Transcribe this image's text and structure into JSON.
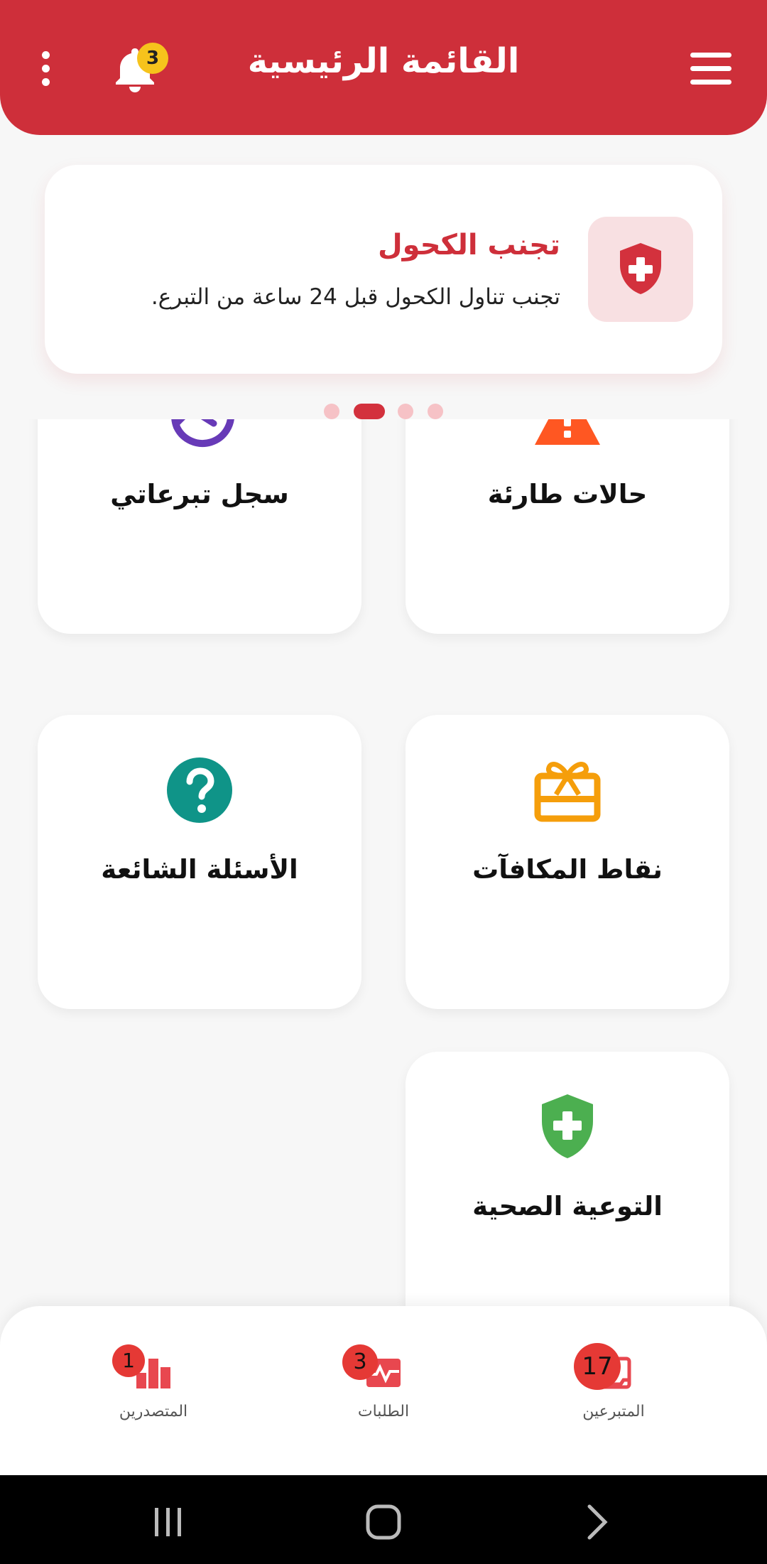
{
  "header": {
    "title": "القائمة الرئيسية",
    "notification_count": "3",
    "accent_color": "#CE2F3A"
  },
  "banner": {
    "title": "تجنب الكحول",
    "text": "تجنب تناول الكحول قبل 24 ساعة من التبرع.",
    "icon": "shield-plus-icon",
    "page_index": 2,
    "page_count": 4
  },
  "grid": {
    "items": [
      {
        "label": "حالات طارئة",
        "icon": "warning-icon",
        "color": "#FF5722"
      },
      {
        "label": "سجل تبرعاتي",
        "icon": "history-icon",
        "color": "#673AB7"
      },
      {
        "label": "نقاط المكافآت",
        "icon": "gift-card-icon",
        "color": "#F59E0B"
      },
      {
        "label": "الأسئلة الشائعة",
        "icon": "question-icon",
        "color": "#0F9488"
      },
      {
        "label": "التوعية الصحية",
        "icon": "health-shield-icon",
        "color": "#4CAF50"
      }
    ]
  },
  "bottom_nav": {
    "items": [
      {
        "label": "المتبرعين",
        "badge": "17",
        "icon": "donors-icon"
      },
      {
        "label": "الطلبات",
        "badge": "3",
        "icon": "requests-icon"
      },
      {
        "label": "المتصدرين",
        "badge": "1",
        "icon": "leaderboard-icon"
      }
    ],
    "icon_color": "#E8474F"
  }
}
